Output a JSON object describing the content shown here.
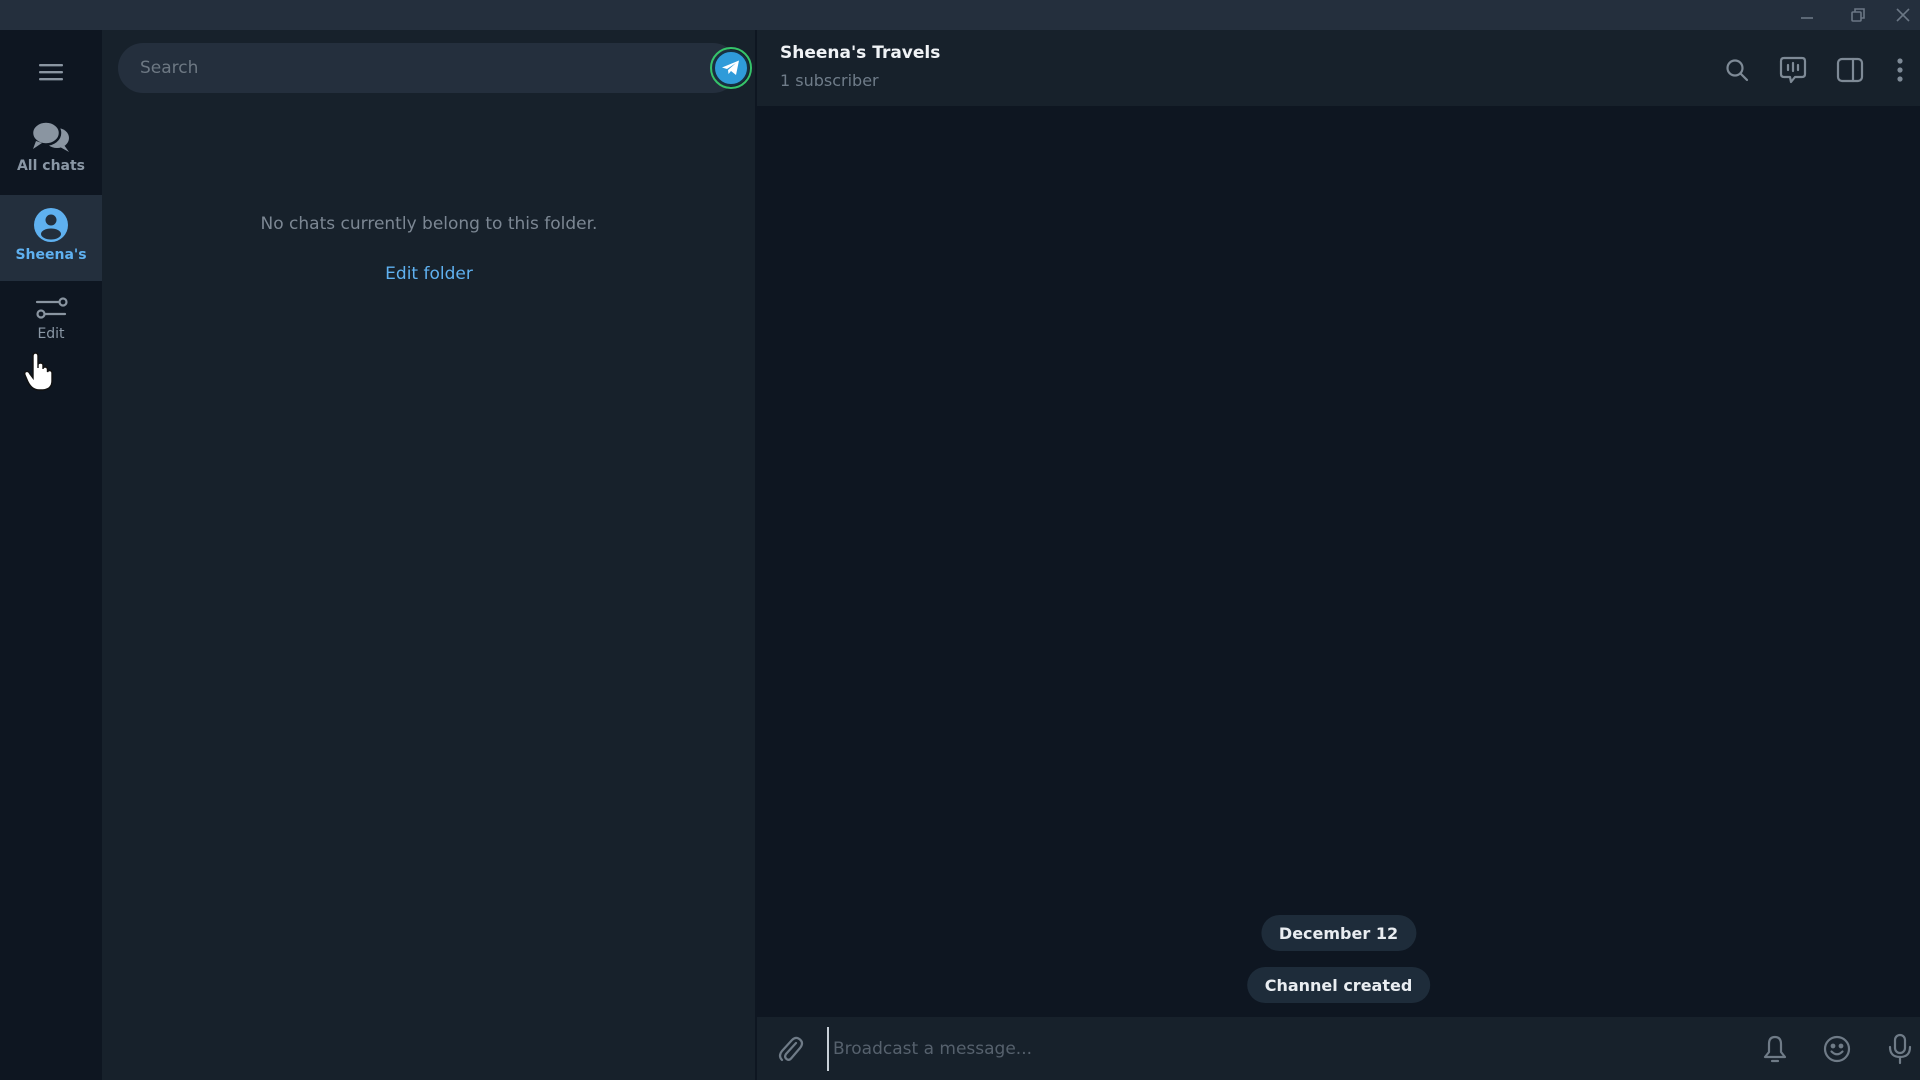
{
  "window": {
    "controls": [
      "minimize",
      "restore",
      "close"
    ]
  },
  "sidebar": {
    "menu_icon": "hamburger-menu-icon",
    "folders": [
      {
        "label": "All chats",
        "icon": "chat-bubbles-icon",
        "active": false
      },
      {
        "label": "Sheena's",
        "icon": "person-icon",
        "active": true
      },
      {
        "label": "Edit",
        "icon": "sliders-icon",
        "active": false
      }
    ]
  },
  "chatlist": {
    "search_placeholder": "Search",
    "search_value": "",
    "status_icon": "telegram-icon",
    "empty_message": "No chats currently belong to this folder.",
    "edit_folder_label": "Edit folder"
  },
  "chat": {
    "title": "Sheena's Travels",
    "subtitle": "1 subscriber",
    "header_icons": [
      "search-icon",
      "voice-chat-icon",
      "side-panel-icon",
      "more-icon"
    ],
    "date_label": "December 12",
    "service_message": "Channel created",
    "compose_placeholder": "Broadcast a message...",
    "compose_value": "",
    "compose_icons": [
      "attach-icon",
      "bell-icon",
      "emoji-icon",
      "microphone-icon"
    ]
  },
  "colors": {
    "accent": "#5fb1f0",
    "panel": "#17212b",
    "background": "#0e1621",
    "titlebar": "#242f3d"
  }
}
